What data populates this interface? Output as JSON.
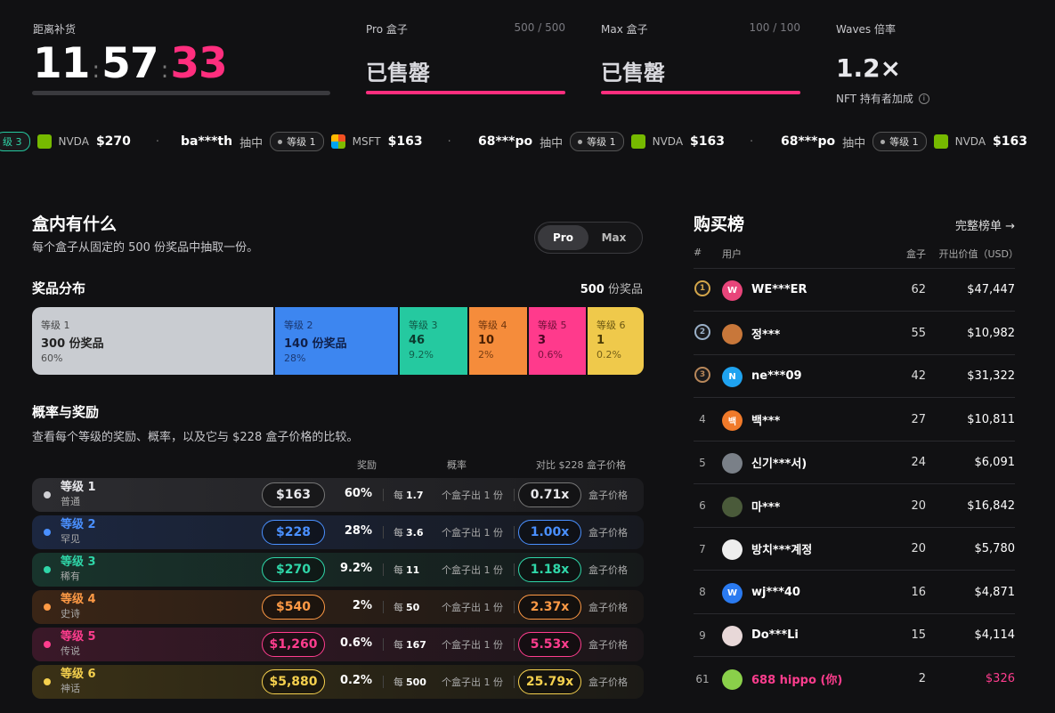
{
  "top": {
    "restock_label": "距离补货",
    "timer": {
      "h": "11",
      "m": "57",
      "s": "33"
    },
    "pro": {
      "label": "Pro 盒子",
      "count": "500 / 500",
      "status": "已售罄"
    },
    "max": {
      "label": "Max 盒子",
      "count": "100 / 100",
      "status": "已售罄"
    },
    "waves": {
      "label": "Waves 倍率",
      "value": "1.2×",
      "note": "NFT 持有者加成"
    }
  },
  "ticker": [
    {
      "partial": "级 3",
      "stock": "NVDA",
      "price": "$270",
      "logo_color": "#76b900"
    },
    {
      "user": "ba***th",
      "verb": "抽中",
      "tier": "等级 1",
      "stock": "MSFT",
      "price": "$163",
      "logo_color": "#f25022"
    },
    {
      "user": "68***po",
      "verb": "抽中",
      "tier": "等级 1",
      "stock": "NVDA",
      "price": "$163",
      "logo_color": "#76b900"
    },
    {
      "user": "68***po",
      "verb": "抽中",
      "tier": "等级 1",
      "stock": "NVDA",
      "price": "$163",
      "logo_color": "#76b900"
    }
  ],
  "contents": {
    "title": "盒内有什么",
    "subtitle": "每个盒子从固定的 500 份奖品中抽取一份。",
    "toggle": [
      "Pro",
      "Max"
    ],
    "dist_title": "奖品分布",
    "dist_total_num": "500",
    "dist_total_unit": "份奖品",
    "segments": [
      {
        "tier": "等级 1",
        "count": "300 份奖品",
        "pct": "60%",
        "bg": "#c9ccd1",
        "fg": "#222"
      },
      {
        "tier": "等级 2",
        "count": "140 份奖品",
        "pct": "28%",
        "bg": "#3d86f0",
        "fg": "#10204a"
      },
      {
        "tier": "等级 3",
        "count": "46",
        "pct": "9.2%",
        "bg": "#25c9a0",
        "fg": "#0b3a2e"
      },
      {
        "tier": "等级 4",
        "count": "10",
        "pct": "2%",
        "bg": "#f58c3b",
        "fg": "#4a1f02"
      },
      {
        "tier": "等级 5",
        "count": "3",
        "pct": "0.6%",
        "bg": "#ff3a8c",
        "fg": "#4a0522"
      },
      {
        "tier": "等级 6",
        "count": "1",
        "pct": "0.2%",
        "bg": "#efc94b",
        "fg": "#4a3a05"
      }
    ],
    "odds_title": "概率与奖励",
    "odds_subtitle": "查看每个等级的奖励、概率，以及它与 $228 盒子价格的比较。",
    "col_reward": "奖励",
    "col_prob": "概率",
    "col_compare": "对比 $228 盒子价格",
    "rows": [
      {
        "tier": "等级 1",
        "sub": "普通",
        "price": "$163",
        "prob": "60%",
        "per_prefix": "每",
        "per_num": "1.7",
        "per_desc": "个盒子出 1 份",
        "mult": "0.71x",
        "mult_label": "盒子价格",
        "color": "#d0d0d4",
        "bg": "linear-gradient(90deg,#2c2c30,#1c1c1f)"
      },
      {
        "tier": "等级 2",
        "sub": "罕见",
        "price": "$228",
        "prob": "28%",
        "per_prefix": "每",
        "per_num": "3.6",
        "per_desc": "个盒子出 1 份",
        "mult": "1.00x",
        "mult_label": "盒子价格",
        "color": "#4a90ff",
        "bg": "linear-gradient(90deg,#1c2740,#17191f)"
      },
      {
        "tier": "等级 3",
        "sub": "稀有",
        "price": "$270",
        "prob": "9.2%",
        "per_prefix": "每",
        "per_num": "11",
        "per_desc": "个盒子出 1 份",
        "mult": "1.18x",
        "mult_label": "盒子价格",
        "color": "#2fd6a8",
        "bg": "linear-gradient(90deg,#18342c,#16191a)"
      },
      {
        "tier": "等级 4",
        "sub": "史诗",
        "price": "$540",
        "prob": "2%",
        "per_prefix": "每",
        "per_num": "50",
        "per_desc": "个盒子出 1 份",
        "mult": "2.37x",
        "mult_label": "盒子价格",
        "color": "#ff9a45",
        "bg": "linear-gradient(90deg,#3a2516,#1a1716)"
      },
      {
        "tier": "等级 5",
        "sub": "传说",
        "price": "$1,260",
        "prob": "0.6%",
        "per_prefix": "每",
        "per_num": "167",
        "per_desc": "个盒子出 1 份",
        "mult": "5.53x",
        "mult_label": "盒子价格",
        "color": "#ff3d8e",
        "bg": "linear-gradient(90deg,#3a1828,#1b1619)"
      },
      {
        "tier": "等级 6",
        "sub": "神话",
        "price": "$5,880",
        "prob": "0.2%",
        "per_prefix": "每",
        "per_num": "500",
        "per_desc": "个盒子出 1 份",
        "mult": "25.79x",
        "mult_label": "盒子价格",
        "color": "#f5d04e",
        "bg": "linear-gradient(90deg,#3a3116,#1b1a16)"
      }
    ]
  },
  "leaderboard": {
    "title": "购买榜",
    "full_link": "完整榜单 →",
    "cols": {
      "rank": "#",
      "user": "用户",
      "boxes": "盒子",
      "value": "开出价值（USD）"
    },
    "rows": [
      {
        "rank": "1",
        "medal": "gold",
        "avatar": "W",
        "av_bg": "#e8457a",
        "user": "WE***ER",
        "boxes": "62",
        "value": "$47,447"
      },
      {
        "rank": "2",
        "medal": "silver",
        "avatar": "",
        "av_bg": "#c8773a",
        "user": "정***",
        "boxes": "55",
        "value": "$10,982"
      },
      {
        "rank": "3",
        "medal": "bronze",
        "avatar": "N",
        "av_bg": "#1fa3f0",
        "user": "ne***09",
        "boxes": "42",
        "value": "$31,322"
      },
      {
        "rank": "4",
        "medal": "",
        "avatar": "백",
        "av_bg": "#f07a2a",
        "user": "백***",
        "boxes": "27",
        "value": "$10,811"
      },
      {
        "rank": "5",
        "medal": "",
        "avatar": "",
        "av_bg": "#7a8088",
        "user": "신기***서)",
        "boxes": "24",
        "value": "$6,091"
      },
      {
        "rank": "6",
        "medal": "",
        "avatar": "",
        "av_bg": "#4a5a3a",
        "user": "마***",
        "boxes": "20",
        "value": "$16,842"
      },
      {
        "rank": "7",
        "medal": "",
        "avatar": "",
        "av_bg": "#eeeeee",
        "user": "방치***계정",
        "boxes": "20",
        "value": "$5,780"
      },
      {
        "rank": "8",
        "medal": "",
        "avatar": "W",
        "av_bg": "#2a7af0",
        "user": "wj***40",
        "boxes": "16",
        "value": "$4,871"
      },
      {
        "rank": "9",
        "medal": "",
        "avatar": "",
        "av_bg": "#e8d8d8",
        "user": "Do***Li",
        "boxes": "15",
        "value": "$4,114"
      },
      {
        "rank": "61",
        "medal": "",
        "avatar": "",
        "av_bg": "#8ad04a",
        "user": "688 hippo (你)",
        "boxes": "2",
        "value": "$326",
        "self": true
      }
    ]
  }
}
